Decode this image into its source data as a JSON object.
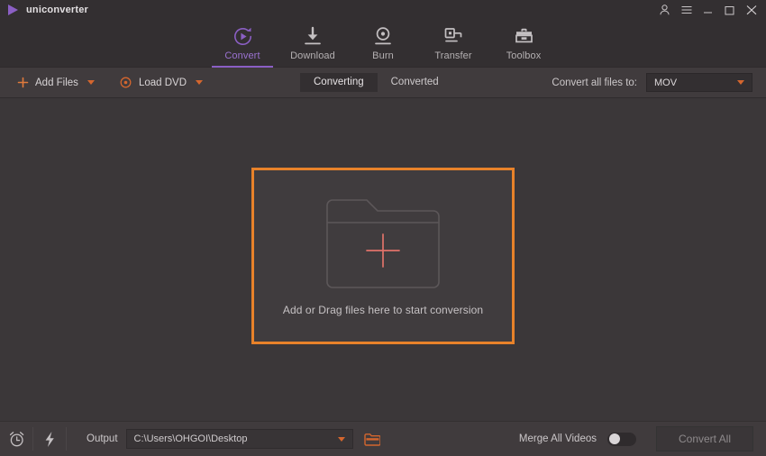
{
  "titlebar": {
    "app_name": "uniconverter",
    "logo_icon": "play-triangle-logo",
    "logo_color": "#8b5fc4",
    "controls": [
      {
        "name": "account",
        "icon": "user-icon"
      },
      {
        "name": "menu",
        "icon": "hamburger-menu-icon"
      },
      {
        "name": "minimize",
        "icon": "minimize-icon"
      },
      {
        "name": "maximize",
        "icon": "maximize-icon"
      },
      {
        "name": "close",
        "icon": "close-icon"
      }
    ]
  },
  "nav": {
    "active_color": "#9a72d0",
    "items": [
      {
        "label": "Convert",
        "icon": "convert-circular-arrow-play-icon",
        "active": true
      },
      {
        "label": "Download",
        "icon": "download-arrow-icon",
        "active": false
      },
      {
        "label": "Burn",
        "icon": "burn-disc-icon",
        "active": false
      },
      {
        "label": "Transfer",
        "icon": "transfer-device-icon",
        "active": false
      },
      {
        "label": "Toolbox",
        "icon": "toolbox-icon",
        "active": false
      }
    ]
  },
  "toolbar": {
    "add_files_label": "Add Files",
    "add_files_icon": "plus-icon",
    "load_dvd_label": "Load DVD",
    "load_dvd_icon": "disc-icon",
    "accent_color": "#d4662e",
    "tabs": [
      {
        "label": "Converting",
        "active": true
      },
      {
        "label": "Converted",
        "active": false
      }
    ],
    "convert_all_to_label": "Convert all files to:",
    "format_value": "MOV"
  },
  "main": {
    "dropzone": {
      "border_color": "#e8822a",
      "folder_icon": "folder-outline-icon",
      "plus_icon": "plus-icon",
      "plus_color": "#e0726a",
      "hint_text": "Add or Drag files here to start conversion"
    }
  },
  "bottombar": {
    "timer_icon": "alarm-clock-icon",
    "speed_icon": "lightning-bolt-icon",
    "output_label": "Output",
    "output_path": "C:\\Users\\OHGOI\\Desktop",
    "browse_icon": "folder-open-icon",
    "browse_icon_color": "#d4662e",
    "merge_label": "Merge All Videos",
    "merge_enabled": false,
    "convert_all_label": "Convert All",
    "convert_all_enabled": false
  }
}
